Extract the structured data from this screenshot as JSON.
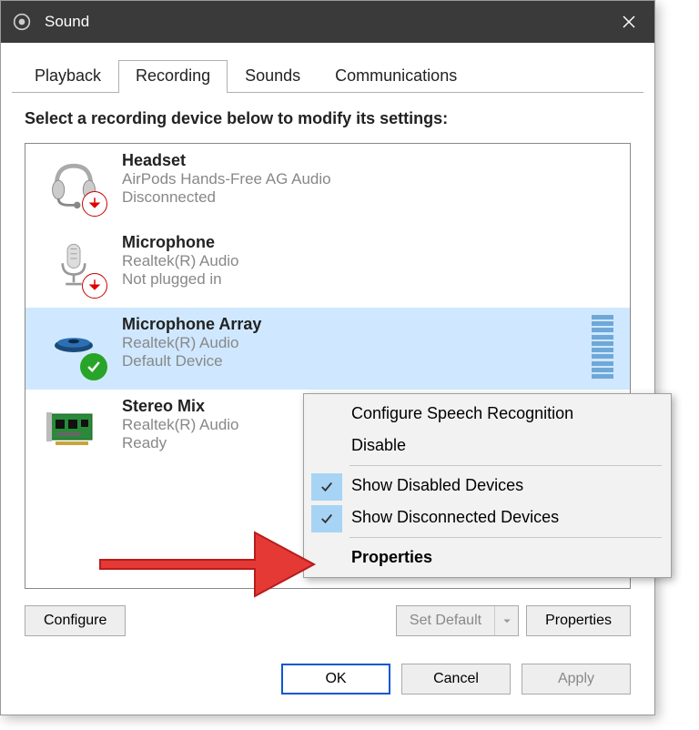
{
  "window": {
    "title": "Sound",
    "close_icon": "close-icon"
  },
  "tabs": [
    {
      "label": "Playback",
      "active": false
    },
    {
      "label": "Recording",
      "active": true
    },
    {
      "label": "Sounds",
      "active": false
    },
    {
      "label": "Communications",
      "active": false
    }
  ],
  "instruction": "Select a recording device below to modify its settings:",
  "devices": [
    {
      "name": "Headset",
      "driver": "AirPods Hands-Free AG Audio",
      "status": "Disconnected",
      "icon": "headset",
      "badge": "down",
      "selected": false
    },
    {
      "name": "Microphone",
      "driver": "Realtek(R) Audio",
      "status": "Not plugged in",
      "icon": "mic",
      "badge": "down",
      "selected": false
    },
    {
      "name": "Microphone Array",
      "driver": "Realtek(R) Audio",
      "status": "Default Device",
      "icon": "mic-array",
      "badge": "check",
      "selected": true,
      "level": true
    },
    {
      "name": "Stereo Mix",
      "driver": "Realtek(R) Audio",
      "status": "Ready",
      "icon": "soundcard",
      "badge": null,
      "selected": false
    }
  ],
  "buttons": {
    "configure": "Configure",
    "set_default": "Set Default",
    "properties": "Properties",
    "ok": "OK",
    "cancel": "Cancel",
    "apply": "Apply"
  },
  "context_menu": {
    "items": [
      {
        "label": "Configure Speech Recognition",
        "checked": false
      },
      {
        "label": "Disable",
        "checked": false
      }
    ],
    "toggle_items": [
      {
        "label": "Show Disabled Devices",
        "checked": true
      },
      {
        "label": "Show Disconnected Devices",
        "checked": true
      }
    ],
    "properties_label": "Properties"
  }
}
